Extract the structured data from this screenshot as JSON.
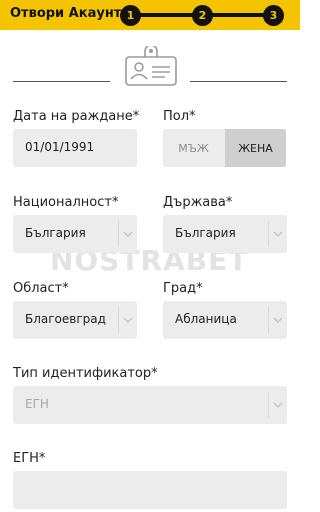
{
  "header": {
    "title": "Отвори Акаунт",
    "steps": [
      "1",
      "2",
      "3"
    ],
    "accent_color": "#f5c400"
  },
  "identity_icon": "id-card-icon",
  "form": {
    "birthdate": {
      "label": "Дата на раждане*",
      "value": "01/01/1991"
    },
    "gender": {
      "label": "Пол*",
      "options": [
        "МЪЖ",
        "ЖЕНА"
      ],
      "selected": "ЖЕНА"
    },
    "nationality": {
      "label": "Националност*",
      "value": "България"
    },
    "country": {
      "label": "Държава*",
      "value": "България"
    },
    "region": {
      "label": "Област*",
      "value": "Благоевград"
    },
    "city": {
      "label": "Град*",
      "value": "Абланица"
    },
    "id_type": {
      "label": "Тип идентификатор*",
      "value": "ЕГН"
    },
    "egn": {
      "label": "ЕГН*",
      "value": ""
    }
  },
  "watermark": "NOSTRABET"
}
